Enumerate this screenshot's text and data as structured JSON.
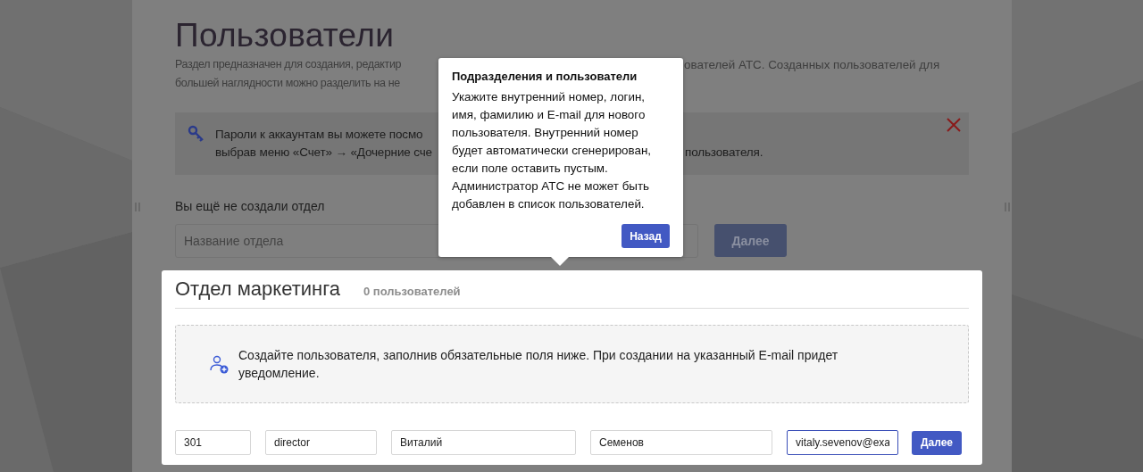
{
  "page": {
    "title": "Пользователи",
    "description": [
      {
        "left": "Раздел предназначен для создания, редактир",
        "right": "ователей АТС. Созданных пользователей для"
      },
      {
        "left": "большей наглядности можно разделить на не"
      }
    ]
  },
  "notice": {
    "lines": [
      {
        "left": "Пароли к аккаунтам вы можете посмо"
      },
      {
        "left": "выбрав меню «Счет» → «Дочерние сче",
        "right": "пользователя."
      }
    ]
  },
  "department_form": {
    "label": "Вы ещё не создали отдел",
    "placeholder": "Название отдела",
    "button": "Далее"
  },
  "department": {
    "name": "Отдел маркетинга",
    "count": "0 пользователей",
    "hint": "Создайте пользователя, заполнив обязательные поля ниже. При создании на указанный E-mail придет уведомление.",
    "fields": [
      {
        "value": "301",
        "focused": false
      },
      {
        "value": "director",
        "focused": false
      },
      {
        "value": "Виталий",
        "focused": false
      },
      {
        "value": "Семенов",
        "focused": false
      },
      {
        "value": "vitaly.sevenov@exa",
        "focused": true
      }
    ],
    "button": "Далее"
  },
  "popover": {
    "title": "Подразделения и пользователи",
    "text": "Укажите внутренний номер, логин, имя, фамилию и E-mail для нового пользователя. Внутренний номер будет автоматически сгенерирован, если поле оставить пустым. Администратор АТС не может быть добавлен в список пользователей.",
    "button": "Назад"
  }
}
